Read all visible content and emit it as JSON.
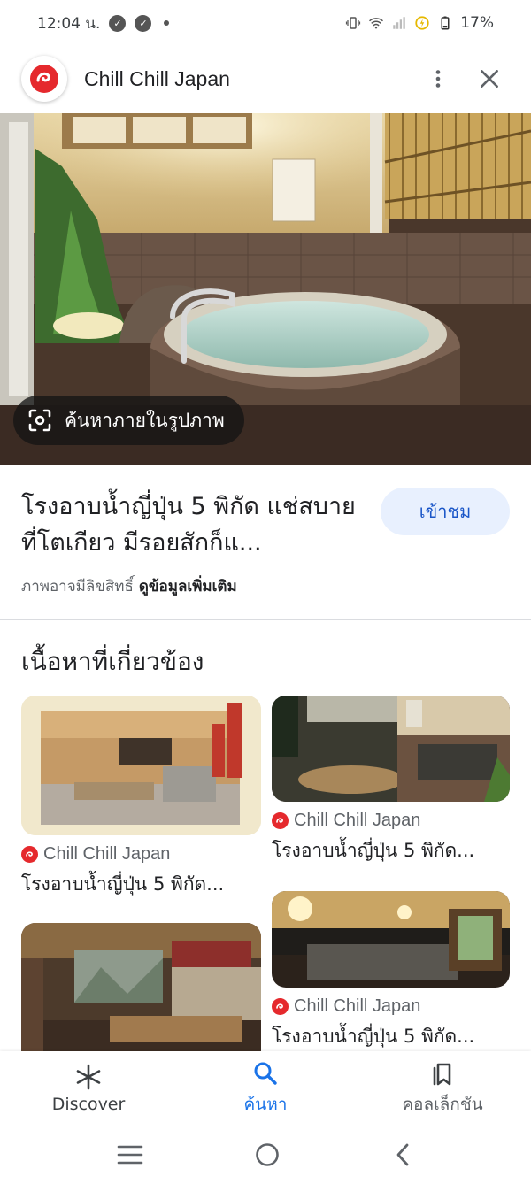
{
  "status_bar": {
    "time": "12:04 น.",
    "battery": "17%"
  },
  "header": {
    "site_name": "Chill Chill Japan"
  },
  "hero": {
    "lens_label": "ค้นหาภายในรูปภาพ"
  },
  "result": {
    "title": "โรงอาบน้ำญี่ปุ่น 5 พิกัด แช่สบายที่โตเกียว มีรอยสักก็แ...",
    "visit_label": "เข้าชม",
    "copyright_notice": "ภาพอาจมีลิขสิทธิ์",
    "more_info": "ดูข้อมูลเพิ่มเติม"
  },
  "related": {
    "heading": "เนื้อหาที่เกี่ยวข้อง",
    "cards": [
      {
        "source": "Chill Chill Japan",
        "title": "โรงอาบน้ำญี่ปุ่น 5 พิกัด..."
      },
      {
        "source": "Chill Chill Japan",
        "title": "โรงอาบน้ำญี่ปุ่น 5 พิกัด..."
      },
      {
        "source": "Chill Chill Japan",
        "title": "โรงอาบน้ำญี่ปุ่น 5 พิกัด..."
      }
    ]
  },
  "bottom_nav": {
    "items": [
      {
        "label": "Discover",
        "icon": "asterisk-icon"
      },
      {
        "label": "ค้นหา",
        "icon": "search-icon"
      },
      {
        "label": "คอลเล็กชัน",
        "icon": "bookmarks-icon"
      }
    ]
  },
  "colors": {
    "accent": "#1a73e8",
    "visit_button_bg": "#e8f0fe",
    "brand_red": "#e5292d"
  }
}
